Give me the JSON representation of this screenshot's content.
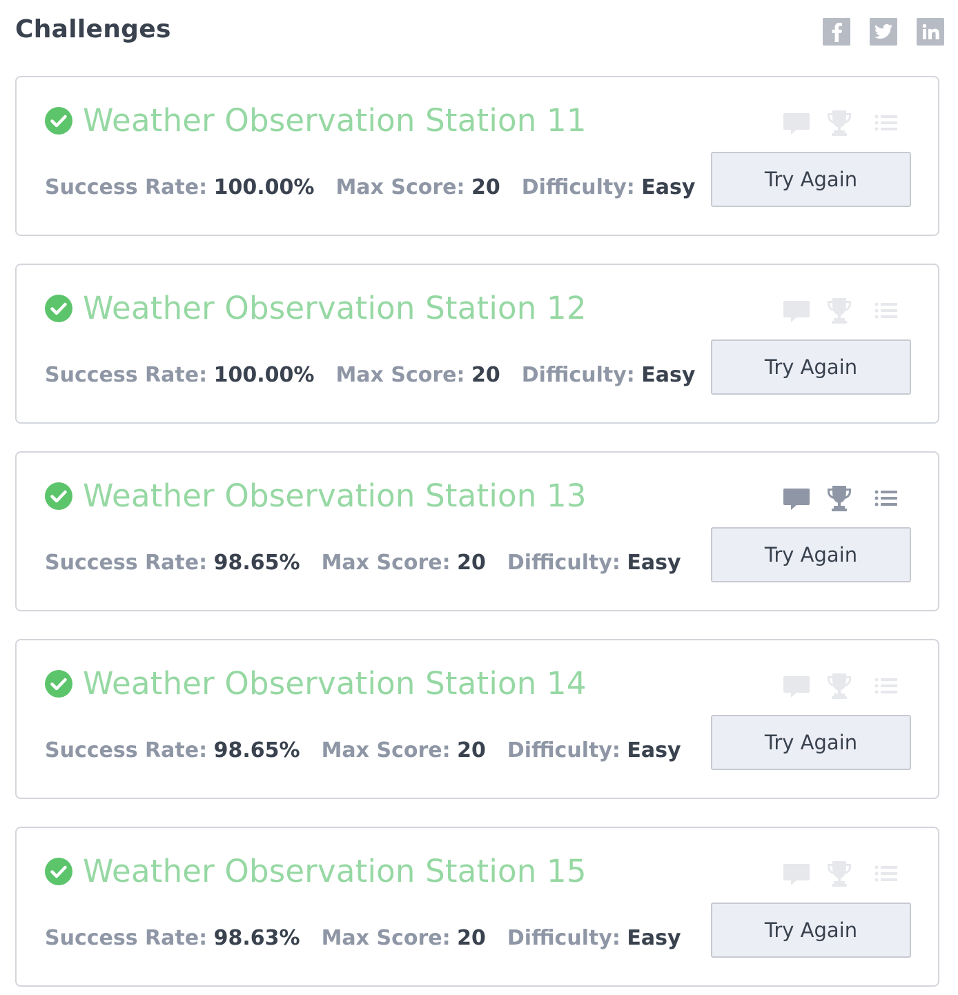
{
  "page": {
    "title": "Challenges"
  },
  "social": [
    {
      "icon": "facebook-icon",
      "glyph": "f"
    },
    {
      "icon": "twitter-icon",
      "glyph": "t"
    },
    {
      "icon": "linkedin-icon",
      "glyph": "in"
    }
  ],
  "labels": {
    "success_rate": "Success Rate:",
    "max_score": "Max Score:",
    "difficulty": "Difficulty:",
    "try_again": "Try Again"
  },
  "colors": {
    "solved_title": "#96d8a3",
    "check": "#5cc46b",
    "icon_muted": "#e6e8ec",
    "icon_active": "#8f97a6"
  },
  "challenges": [
    {
      "title": "Weather Observation Station 11",
      "success_rate": "100.00%",
      "max_score": "20",
      "difficulty": "Easy",
      "solved": true,
      "icons_active": false
    },
    {
      "title": "Weather Observation Station 12",
      "success_rate": "100.00%",
      "max_score": "20",
      "difficulty": "Easy",
      "solved": true,
      "icons_active": false
    },
    {
      "title": "Weather Observation Station 13",
      "success_rate": "98.65%",
      "max_score": "20",
      "difficulty": "Easy",
      "solved": true,
      "icons_active": true
    },
    {
      "title": "Weather Observation Station 14",
      "success_rate": "98.65%",
      "max_score": "20",
      "difficulty": "Easy",
      "solved": true,
      "icons_active": false
    },
    {
      "title": "Weather Observation Station 15",
      "success_rate": "98.63%",
      "max_score": "20",
      "difficulty": "Easy",
      "solved": true,
      "icons_active": false
    }
  ]
}
